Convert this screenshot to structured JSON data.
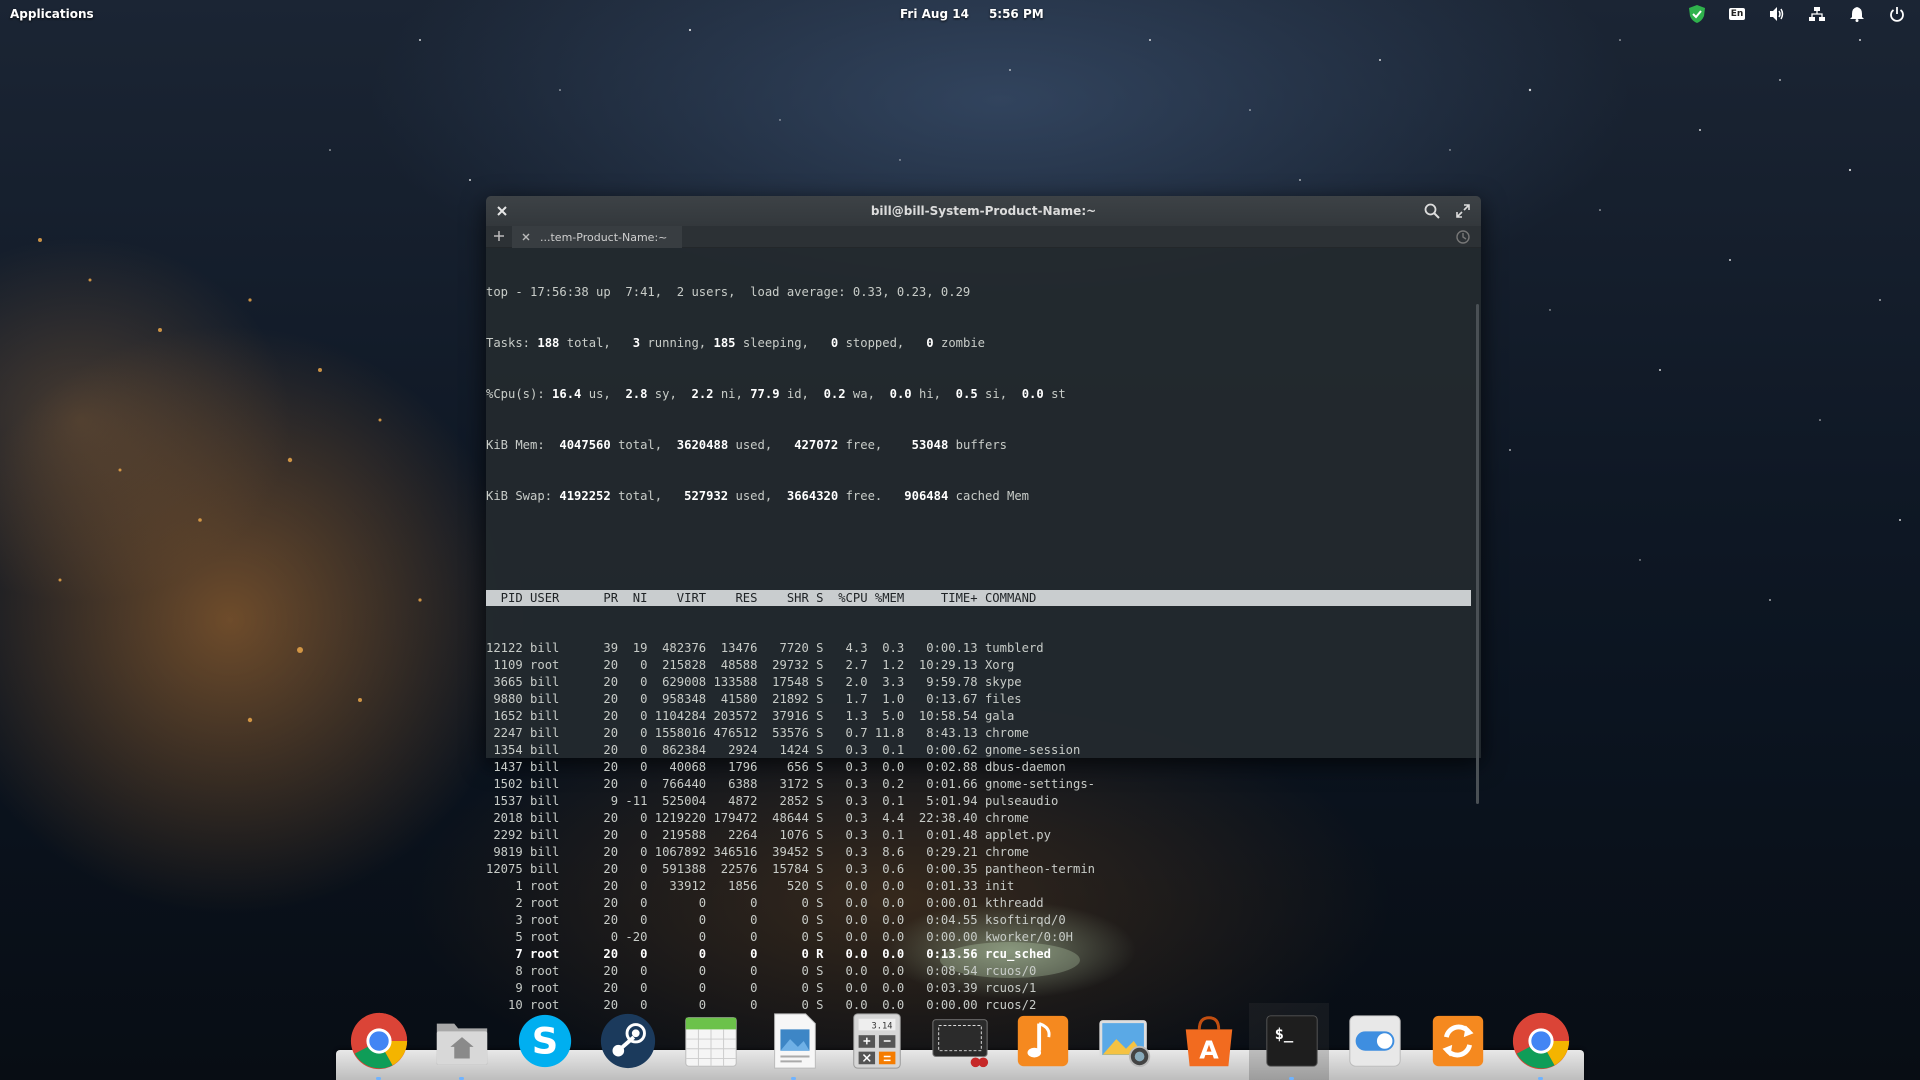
{
  "panel": {
    "applications_label": "Applications",
    "date": "Fri Aug 14",
    "time": "5:56 PM",
    "indicators": [
      "check-shield-icon",
      "keyboard-layout-icon",
      "volume-icon",
      "network-icon",
      "notifications-icon",
      "power-icon"
    ],
    "keyboard_layout": "En",
    "accent_green": "#2fb24c"
  },
  "terminal": {
    "title": "bill@bill-System-Product-Name:~",
    "tab_label": "...tem-Product-Name:~",
    "summary": {
      "line1": "top - 17:56:38 up  7:41,  2 users,  load average: 0.33, 0.23, 0.29",
      "tasks_label": "Tasks:",
      "tasks_total": "188",
      "tasks_total_suffix": " total,   ",
      "tasks_running": "3",
      "tasks_running_suffix": " running, ",
      "tasks_sleeping": "185",
      "tasks_sleeping_suffix": " sleeping,   ",
      "tasks_stopped": "0",
      "tasks_stopped_suffix": " stopped,   ",
      "tasks_zombie": "0",
      "tasks_zombie_suffix": " zombie",
      "cpu_label": "%Cpu(s): ",
      "cpu_us": "16.4",
      "cpu_us_suffix": " us,  ",
      "cpu_sy": "2.8",
      "cpu_sy_suffix": " sy,  ",
      "cpu_ni": "2.2",
      "cpu_ni_suffix": " ni, ",
      "cpu_id": "77.9",
      "cpu_id_suffix": " id,  ",
      "cpu_wa": "0.2",
      "cpu_wa_suffix": " wa,  ",
      "cpu_hi": "0.0",
      "cpu_hi_suffix": " hi,  ",
      "cpu_si": "0.5",
      "cpu_si_suffix": " si,  ",
      "cpu_st": "0.0",
      "cpu_st_suffix": " st",
      "mem_label": "KiB Mem:  ",
      "mem_total": "4047560",
      "mem_total_suffix": " total,  ",
      "mem_used": "3620488",
      "mem_used_suffix": " used,   ",
      "mem_free": "427072",
      "mem_free_suffix": " free,    ",
      "mem_buffers": "53048",
      "mem_buffers_suffix": " buffers",
      "swap_label": "KiB Swap: ",
      "swap_total": "4192252",
      "swap_total_suffix": " total,   ",
      "swap_used": "527932",
      "swap_used_suffix": " used,  ",
      "swap_free": "3664320",
      "swap_free_suffix": " free.   ",
      "swap_cached": "906484",
      "swap_cached_suffix": " cached Mem"
    },
    "header": "  PID USER      PR  NI    VIRT    RES    SHR S  %CPU %MEM     TIME+ COMMAND",
    "rows": [
      {
        "text": "12122 bill      39  19  482376  13476   7720 S   4.3  0.3   0:00.13 tumblerd",
        "bold": false
      },
      {
        "text": " 1109 root      20   0  215828  48588  29732 S   2.7  1.2  10:29.13 Xorg",
        "bold": false
      },
      {
        "text": " 3665 bill      20   0  629008 133588  17548 S   2.0  3.3   9:59.78 skype",
        "bold": false
      },
      {
        "text": " 9880 bill      20   0  958348  41580  21892 S   1.7  1.0   0:13.67 files",
        "bold": false
      },
      {
        "text": " 1652 bill      20   0 1104284 203572  37916 S   1.3  5.0  10:58.54 gala",
        "bold": false
      },
      {
        "text": " 2247 bill      20   0 1558016 476512  53576 S   0.7 11.8   8:43.13 chrome",
        "bold": false
      },
      {
        "text": " 1354 bill      20   0  862384   2924   1424 S   0.3  0.1   0:00.62 gnome-session",
        "bold": false
      },
      {
        "text": " 1437 bill      20   0   40068   1796    656 S   0.3  0.0   0:02.88 dbus-daemon",
        "bold": false
      },
      {
        "text": " 1502 bill      20   0  766440   6388   3172 S   0.3  0.2   0:01.66 gnome-settings-",
        "bold": false
      },
      {
        "text": " 1537 bill       9 -11  525004   4872   2852 S   0.3  0.1   5:01.94 pulseaudio",
        "bold": false
      },
      {
        "text": " 2018 bill      20   0 1219220 179472  48644 S   0.3  4.4  22:38.40 chrome",
        "bold": false
      },
      {
        "text": " 2292 bill      20   0  219588   2264   1076 S   0.3  0.1   0:01.48 applet.py",
        "bold": false
      },
      {
        "text": " 9819 bill      20   0 1067892 346516  39452 S   0.3  8.6   0:29.21 chrome",
        "bold": false
      },
      {
        "text": "12075 bill      20   0  591388  22576  15784 S   0.3  0.6   0:00.35 pantheon-termin",
        "bold": false
      },
      {
        "text": "    1 root      20   0   33912   1856    520 S   0.0  0.0   0:01.33 init",
        "bold": false
      },
      {
        "text": "    2 root      20   0       0      0      0 S   0.0  0.0   0:00.01 kthreadd",
        "bold": false
      },
      {
        "text": "    3 root      20   0       0      0      0 S   0.0  0.0   0:04.55 ksoftirqd/0",
        "bold": false
      },
      {
        "text": "    5 root       0 -20       0      0      0 S   0.0  0.0   0:00.00 kworker/0:0H",
        "bold": false
      },
      {
        "text": "    7 root      20   0       0      0      0 R   0.0  0.0   0:13.56 rcu_sched",
        "bold": true
      },
      {
        "text": "    8 root      20   0       0      0      0 S   0.0  0.0   0:08.54 rcuos/0",
        "bold": false
      },
      {
        "text": "    9 root      20   0       0      0      0 S   0.0  0.0   0:03.39 rcuos/1",
        "bold": false
      },
      {
        "text": "   10 root      20   0       0      0      0 S   0.0  0.0   0:00.00 rcuos/2",
        "bold": false
      }
    ]
  },
  "dock": {
    "items": [
      {
        "name": "chrome-icon",
        "running": true
      },
      {
        "name": "files-home-icon",
        "running": true
      },
      {
        "name": "skype-icon",
        "running": false
      },
      {
        "name": "steam-icon",
        "running": false
      },
      {
        "name": "calendar-icon",
        "running": false
      },
      {
        "name": "document-viewer-icon",
        "running": true
      },
      {
        "name": "calculator-icon",
        "running": false
      },
      {
        "name": "screenshot-icon",
        "running": false
      },
      {
        "name": "music-icon",
        "running": false
      },
      {
        "name": "photos-icon",
        "running": false
      },
      {
        "name": "app-center-icon",
        "running": false
      },
      {
        "name": "terminal-icon",
        "running": true
      },
      {
        "name": "system-settings-toggle-icon",
        "running": false
      },
      {
        "name": "software-update-icon",
        "running": false
      },
      {
        "name": "chrome-icon",
        "running": true
      }
    ],
    "calculator_display": "3.14"
  }
}
